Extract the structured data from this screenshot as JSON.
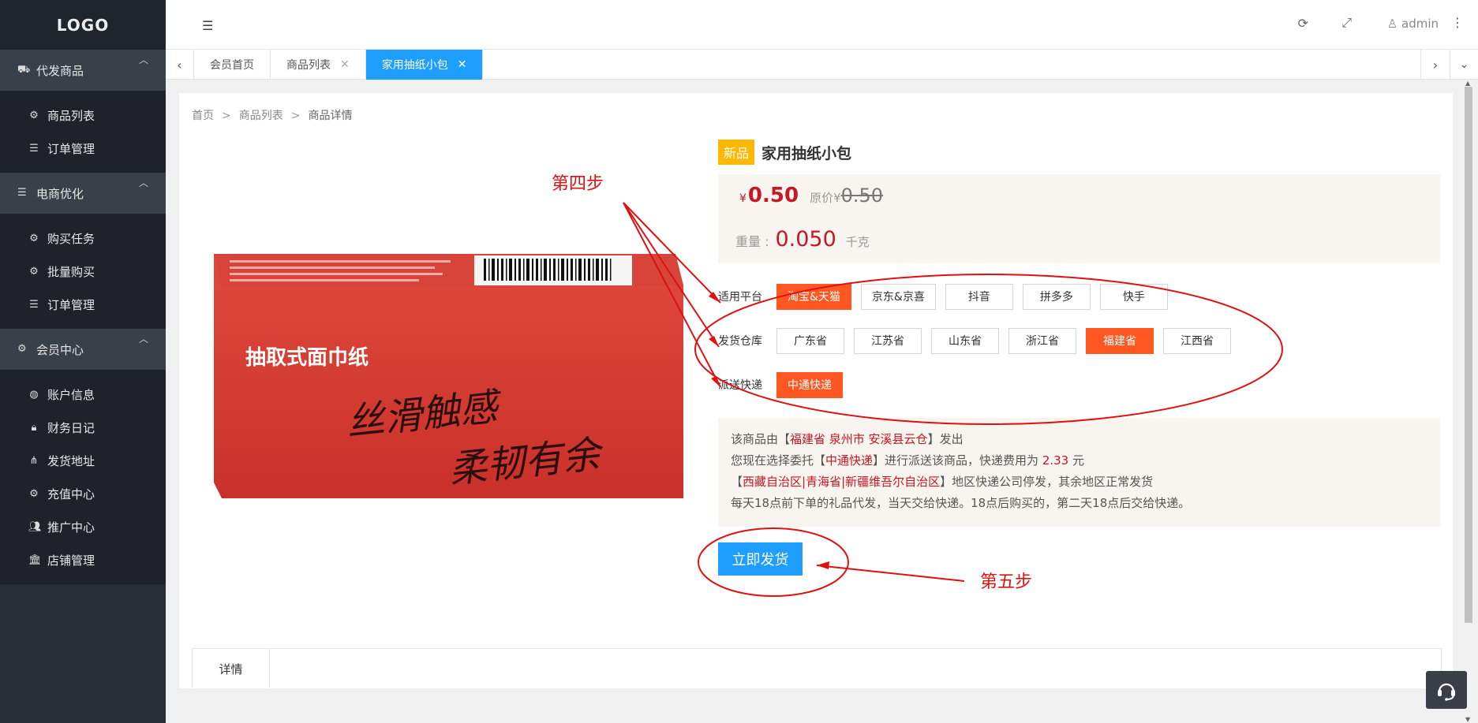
{
  "sidebar": {
    "logo": "LOGO",
    "groups": [
      {
        "label": "代发商品",
        "icon": "truck-icon",
        "items": [
          {
            "label": "商品列表",
            "icon": "gears-icon"
          },
          {
            "label": "订单管理",
            "icon": "list-icon"
          }
        ]
      },
      {
        "label": "电商优化",
        "icon": "list-icon",
        "items": [
          {
            "label": "购买任务",
            "icon": "gears-icon"
          },
          {
            "label": "批量购买",
            "icon": "gears-icon"
          },
          {
            "label": "订单管理",
            "icon": "list-icon"
          }
        ]
      },
      {
        "label": "会员中心",
        "icon": "gear-icon",
        "items": [
          {
            "label": "账户信息",
            "icon": "globe-icon"
          },
          {
            "label": "财务日记",
            "icon": "lock-icon"
          },
          {
            "label": "发货地址",
            "icon": "sitemap-icon"
          },
          {
            "label": "充值中心",
            "icon": "gears-icon"
          },
          {
            "label": "推广中心",
            "icon": "users-icon"
          },
          {
            "label": "店铺管理",
            "icon": "bank-icon"
          }
        ]
      }
    ]
  },
  "header": {
    "user": "admin"
  },
  "tabs": [
    {
      "label": "会员首页",
      "closable": false,
      "active": false
    },
    {
      "label": "商品列表",
      "closable": true,
      "active": false
    },
    {
      "label": "家用抽纸小包",
      "closable": true,
      "active": true
    }
  ],
  "breadcrumb": [
    "首页",
    "商品列表",
    "商品详情"
  ],
  "product": {
    "badge": "新品",
    "name": "家用抽纸小包",
    "currency": "¥",
    "price": "0.50",
    "orig_label": "原价",
    "orig_price": "0.50",
    "weight_label": "重量 :",
    "weight": "0.050",
    "weight_unit": "千克",
    "image_text_1": "抽取式面巾纸",
    "image_text_2": "丝滑触感",
    "image_text_3": "柔韧有余"
  },
  "options": {
    "platform": {
      "label": "适用平台",
      "values": [
        "淘宝&天猫",
        "京东&京喜",
        "抖音",
        "拼多多",
        "快手"
      ],
      "selected": 0
    },
    "warehouse": {
      "label": "发货仓库",
      "values": [
        "广东省",
        "江苏省",
        "山东省",
        "浙江省",
        "福建省",
        "江西省"
      ],
      "selected": 4
    },
    "courier": {
      "label": "派送快递",
      "values": [
        "中通快递"
      ],
      "selected": 0
    }
  },
  "info": {
    "l1_a": "该商品由【",
    "l1_hl": "福建省 泉州市 安溪县云仓",
    "l1_b": "】发出",
    "l2_a": "您现在选择委托【",
    "l2_hl": "中通快递",
    "l2_b": "】进行派送该商品，快递费用为 ",
    "l2_fee": "2.33",
    "l2_c": " 元",
    "l3_a": "【",
    "l3_hl": "西藏自治区|青海省|新疆维吾尔自治区",
    "l3_b": "】地区快递公司停发，其余地区正常发货",
    "l4": "每天18点前下单的礼品代发，当天交给快递。18点后购买的，第二天18点后交给快递。"
  },
  "ship_button": "立即发货",
  "detail_tab": "详情",
  "annotations": {
    "step4": "第四步",
    "step5": "第五步",
    "color": "#e01010"
  },
  "colors": {
    "primary": "#1e9fff",
    "selected": "#ff5722",
    "price": "#c81623",
    "badge": "#ffb800",
    "sidebar": "#2a2f37"
  }
}
